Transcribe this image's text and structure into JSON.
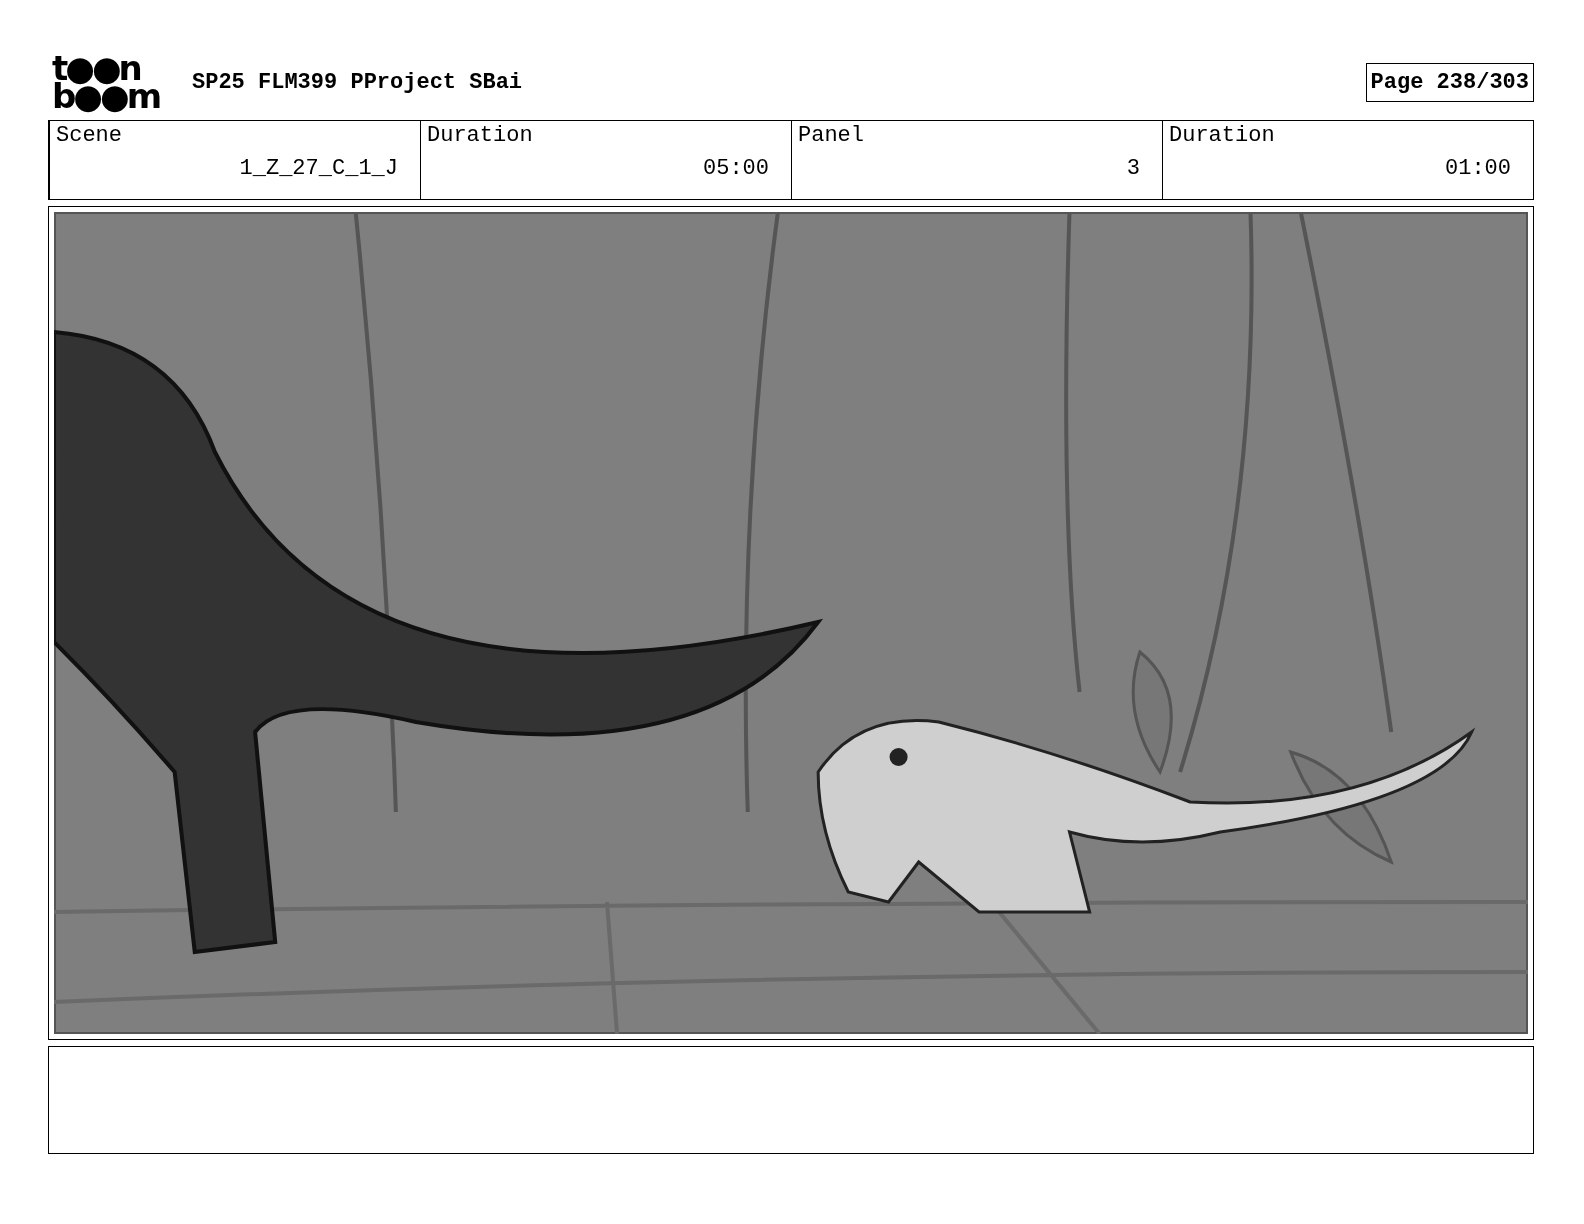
{
  "logo": {
    "top": "t●●n",
    "bottom": "b●●m"
  },
  "title": "SP25 FLM399 PProject SBai",
  "page": "Page 238/303",
  "fields": [
    {
      "label": "Scene",
      "value": "1_Z_27_C_1_J"
    },
    {
      "label": "Duration",
      "value": "05:00"
    },
    {
      "label": "Panel",
      "value": "3"
    },
    {
      "label": "Duration",
      "value": "01:00"
    }
  ]
}
